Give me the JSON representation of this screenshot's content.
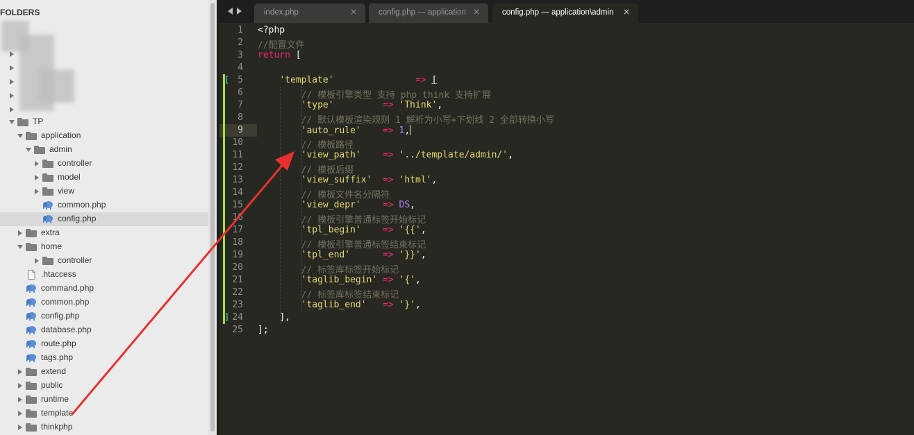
{
  "sidebar": {
    "header": "FOLDERS",
    "tree": [
      {
        "label": "TP",
        "type": "folder",
        "state": "open"
      },
      {
        "label": "application",
        "type": "folder",
        "state": "open"
      },
      {
        "label": "admin",
        "type": "folder",
        "state": "open"
      },
      {
        "label": "controller",
        "type": "folder",
        "state": "closed"
      },
      {
        "label": "model",
        "type": "folder",
        "state": "closed"
      },
      {
        "label": "view",
        "type": "folder",
        "state": "closed"
      },
      {
        "label": "common.php",
        "type": "php-file"
      },
      {
        "label": "config.php",
        "type": "php-file",
        "selected": true
      },
      {
        "label": "extra",
        "type": "folder",
        "state": "closed"
      },
      {
        "label": "home",
        "type": "folder",
        "state": "open"
      },
      {
        "label": "controller",
        "type": "folder",
        "state": "closed"
      },
      {
        "label": ".htaccess",
        "type": "plain-file"
      },
      {
        "label": "command.php",
        "type": "php-file"
      },
      {
        "label": "common.php",
        "type": "php-file"
      },
      {
        "label": "config.php",
        "type": "php-file"
      },
      {
        "label": "database.php",
        "type": "php-file"
      },
      {
        "label": "route.php",
        "type": "php-file"
      },
      {
        "label": "tags.php",
        "type": "php-file"
      },
      {
        "label": "extend",
        "type": "folder",
        "state": "closed"
      },
      {
        "label": "public",
        "type": "folder",
        "state": "closed"
      },
      {
        "label": "runtime",
        "type": "folder",
        "state": "closed"
      },
      {
        "label": "template",
        "type": "folder",
        "state": "closed"
      },
      {
        "label": "thinkphp",
        "type": "folder",
        "state": "closed"
      }
    ]
  },
  "tabs": [
    {
      "title": "index.php",
      "close": "×",
      "active": false
    },
    {
      "title": "config.php — application",
      "close": "×",
      "active": false
    },
    {
      "title": "config.php — application\\admin",
      "close": "×",
      "active": true
    }
  ],
  "editor": {
    "current_line": 9,
    "lines": [
      {
        "n": "1",
        "tokens": [
          [
            "plain",
            "<?php"
          ]
        ]
      },
      {
        "n": "2",
        "tokens": [
          [
            "cmt",
            "//配置文件"
          ]
        ]
      },
      {
        "n": "3",
        "tokens": [
          [
            "kw",
            "return"
          ],
          [
            "plain",
            " ["
          ]
        ]
      },
      {
        "n": "4",
        "tokens": []
      },
      {
        "n": "5",
        "tokens": [
          [
            "plain",
            "    "
          ],
          [
            "str",
            "'template'"
          ],
          [
            "plain",
            "               "
          ],
          [
            "op",
            "=>"
          ],
          [
            "plain",
            " "
          ],
          [
            "plain-ul",
            "["
          ]
        ],
        "fold": "["
      },
      {
        "n": "6",
        "tokens": [
          [
            "plain",
            "        "
          ],
          [
            "cmt",
            "// 模板引擎类型 支持 php think 支持扩展"
          ]
        ]
      },
      {
        "n": "7",
        "tokens": [
          [
            "plain",
            "        "
          ],
          [
            "str",
            "'type'"
          ],
          [
            "plain",
            "         "
          ],
          [
            "op",
            "=>"
          ],
          [
            "plain",
            " "
          ],
          [
            "str",
            "'Think'"
          ],
          [
            "plain",
            ","
          ]
        ]
      },
      {
        "n": "8",
        "tokens": [
          [
            "plain",
            "        "
          ],
          [
            "cmt",
            "// 默认模板渲染规则 1 解析为小写+下划线 2 全部转换小写"
          ]
        ]
      },
      {
        "n": "9",
        "tokens": [
          [
            "plain",
            "        "
          ],
          [
            "str",
            "'auto_rule'"
          ],
          [
            "plain",
            "    "
          ],
          [
            "op",
            "=>"
          ],
          [
            "plain",
            " "
          ],
          [
            "num",
            "1"
          ],
          [
            "plain",
            ","
          ]
        ],
        "cursor": true
      },
      {
        "n": "10",
        "tokens": [
          [
            "plain",
            "        "
          ],
          [
            "cmt",
            "// 模板路径"
          ]
        ]
      },
      {
        "n": "11",
        "tokens": [
          [
            "plain",
            "        "
          ],
          [
            "str",
            "'view_path'"
          ],
          [
            "plain",
            "    "
          ],
          [
            "op",
            "=>"
          ],
          [
            "plain",
            " "
          ],
          [
            "str",
            "'../template/admin/'"
          ],
          [
            "plain",
            ","
          ]
        ]
      },
      {
        "n": "12",
        "tokens": [
          [
            "plain",
            "        "
          ],
          [
            "cmt",
            "// 模板后缀"
          ]
        ]
      },
      {
        "n": "13",
        "tokens": [
          [
            "plain",
            "        "
          ],
          [
            "str",
            "'view_suffix'"
          ],
          [
            "plain",
            "  "
          ],
          [
            "op",
            "=>"
          ],
          [
            "plain",
            " "
          ],
          [
            "str",
            "'html'"
          ],
          [
            "plain",
            ","
          ]
        ]
      },
      {
        "n": "14",
        "tokens": [
          [
            "plain",
            "        "
          ],
          [
            "cmt",
            "// 模板文件名分隔符"
          ]
        ]
      },
      {
        "n": "15",
        "tokens": [
          [
            "plain",
            "        "
          ],
          [
            "str",
            "'view_depr'"
          ],
          [
            "plain",
            "    "
          ],
          [
            "op",
            "=>"
          ],
          [
            "plain",
            " "
          ],
          [
            "cst",
            "DS"
          ],
          [
            "plain",
            ","
          ]
        ]
      },
      {
        "n": "16",
        "tokens": [
          [
            "plain",
            "        "
          ],
          [
            "cmt",
            "// 模板引擎普通标签开始标记"
          ]
        ]
      },
      {
        "n": "17",
        "tokens": [
          [
            "plain",
            "        "
          ],
          [
            "str",
            "'tpl_begin'"
          ],
          [
            "plain",
            "    "
          ],
          [
            "op",
            "=>"
          ],
          [
            "plain",
            " "
          ],
          [
            "str",
            "'{{'"
          ],
          [
            "plain",
            ","
          ]
        ]
      },
      {
        "n": "18",
        "tokens": [
          [
            "plain",
            "        "
          ],
          [
            "cmt",
            "// 模板引擎普通标签结束标记"
          ]
        ]
      },
      {
        "n": "19",
        "tokens": [
          [
            "plain",
            "        "
          ],
          [
            "str",
            "'tpl_end'"
          ],
          [
            "plain",
            "      "
          ],
          [
            "op",
            "=>"
          ],
          [
            "plain",
            " "
          ],
          [
            "str",
            "'}}'"
          ],
          [
            "plain",
            ","
          ]
        ]
      },
      {
        "n": "20",
        "tokens": [
          [
            "plain",
            "        "
          ],
          [
            "cmt",
            "// 标签库标签开始标记"
          ]
        ]
      },
      {
        "n": "21",
        "tokens": [
          [
            "plain",
            "        "
          ],
          [
            "str",
            "'taglib_begin'"
          ],
          [
            "plain",
            " "
          ],
          [
            "op",
            "=>"
          ],
          [
            "plain",
            " "
          ],
          [
            "str",
            "'{'"
          ],
          [
            "plain",
            ","
          ]
        ]
      },
      {
        "n": "22",
        "tokens": [
          [
            "plain",
            "        "
          ],
          [
            "cmt",
            "// 标签库标签结束标记"
          ]
        ]
      },
      {
        "n": "23",
        "tokens": [
          [
            "plain",
            "        "
          ],
          [
            "str",
            "'taglib_end'"
          ],
          [
            "plain",
            "   "
          ],
          [
            "op",
            "=>"
          ],
          [
            "plain",
            " "
          ],
          [
            "str",
            "'}'"
          ],
          [
            "plain",
            ","
          ]
        ]
      },
      {
        "n": "24",
        "tokens": [
          [
            "plain",
            "    "
          ],
          [
            "plain",
            "],"
          ]
        ],
        "fold": "]"
      },
      {
        "n": "25",
        "tokens": [
          [
            "plain",
            "];"
          ]
        ]
      }
    ]
  },
  "colors": {
    "sidebar_bg": "#ebebeb",
    "editor_bg": "#272822",
    "tab_active_bg": "#272822",
    "string": "#e6db74",
    "keyword": "#f92672",
    "comment": "#75715e",
    "number": "#ae81ff",
    "annotation_arrow": "#e8312f"
  }
}
